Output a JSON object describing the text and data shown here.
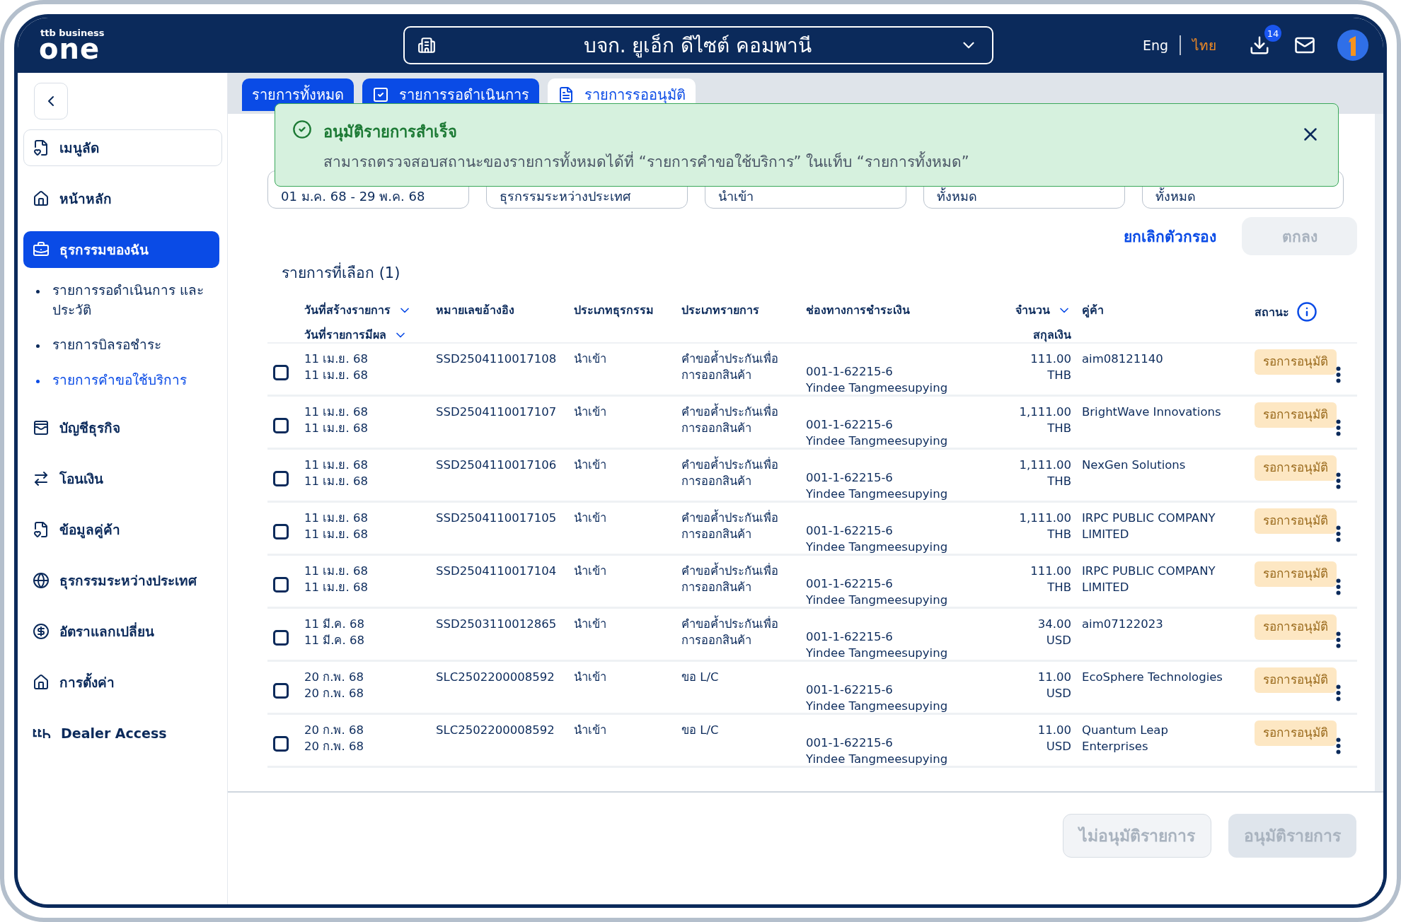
{
  "header": {
    "logo": {
      "tagline": "ttb business",
      "brand": "one"
    },
    "company": "บจก. ยูเอ็ก ดีไซต์ คอมพานี",
    "languages": [
      {
        "label": "Eng",
        "selected": false
      },
      {
        "label": "ไทย",
        "selected": true
      }
    ],
    "download_badge": "14"
  },
  "sidebar": {
    "items": [
      {
        "kind": "shortcut",
        "label": "เมนูลัด",
        "selected": false
      },
      {
        "kind": "nav",
        "label": "หน้าหลัก",
        "selected": false
      },
      {
        "kind": "nav",
        "label": "ธุรกรรมของฉัน",
        "selected": true,
        "children": [
          {
            "label": "รายการรอดำเนินการ และประวัติ",
            "selected": false
          },
          {
            "label": "รายการบิลรอชำระ",
            "selected": false
          },
          {
            "label": "รายการคำขอใช้บริการ",
            "selected": true
          }
        ]
      },
      {
        "kind": "nav",
        "label": "บัญชีธุรกิจ",
        "selected": false
      },
      {
        "kind": "nav",
        "label": "โอนเงิน",
        "selected": false
      },
      {
        "kind": "nav",
        "label": "ข้อมูลคู่ค้า",
        "selected": false
      },
      {
        "kind": "nav",
        "label": "ธุรกรรมระหว่างประเทศ",
        "selected": false
      },
      {
        "kind": "nav",
        "label": "อัตราแลกเปลี่ยน",
        "selected": false
      },
      {
        "kind": "nav",
        "label": "การตั้งค่า",
        "selected": false
      },
      {
        "kind": "nav",
        "label": "Dealer Access",
        "selected": false
      }
    ]
  },
  "tabs": [
    {
      "label": "รายการทั้งหมด",
      "selected": false
    },
    {
      "label": "รายการรอดำเนินการ",
      "selected": false
    },
    {
      "label": "รายการรออนุมัติ",
      "selected": true
    }
  ],
  "toast": {
    "title": "อนุมัติรายการสำเร็จ",
    "message": "สามารถตรวจสอบสถานะของรายการทั้งหมดได้ที่ “รายการคำขอใช้บริการ” ในแท็บ “รายการทั้งหมด”"
  },
  "filters": [
    "01 ม.ค. 68 - 29 พ.ค. 68",
    "ธุรกรรมระหว่างประเทศ",
    "นำเข้า",
    "ทั้งหมด",
    "ทั้งหมด"
  ],
  "filter_actions": {
    "clear": "ยกเลิกตัวกรอง",
    "apply": {
      "label": "ตกลง",
      "disabled": true
    }
  },
  "selected_count": "รายการที่เลือก (1)",
  "table": {
    "columns": [
      {
        "lines": [
          {
            "label": "วันที่สร้างรายการ",
            "sortable": true
          },
          {
            "label": "วันที่รายการมีผล",
            "sortable": true
          }
        ]
      },
      {
        "lines": [
          {
            "label": "หมายเลขอ้างอิง"
          }
        ]
      },
      {
        "lines": [
          {
            "label": "ประเภทธุรกรรม"
          }
        ]
      },
      {
        "lines": [
          {
            "label": "ประเภทรายการ"
          }
        ]
      },
      {
        "lines": [
          {
            "label": "ช่องทางการชำระเงิน"
          }
        ]
      },
      {
        "lines": [
          {
            "label": "จำนวน",
            "sortable": true
          },
          {
            "label": "สกุลเงิน"
          }
        ]
      },
      {
        "lines": [
          {
            "label": "คู่ค้า"
          }
        ]
      },
      {
        "lines": [
          {
            "label": "สถานะ"
          }
        ]
      }
    ],
    "rows": [
      {
        "checked": false,
        "created": "11 เม.ย. 68",
        "effective": "11 เม.ย. 68",
        "reference": "SSD2504110017108",
        "transaction_type": "นำเข้า",
        "item_type": "คำขอค้ำประกันเพื่อการออกสินค้า",
        "account": "001-1-62215-6",
        "account_name": "Yindee Tangmeesupying",
        "amount": "111.00",
        "currency": "THB",
        "partner": "aim08121140",
        "status": "รอการอนุมัติ"
      },
      {
        "checked": false,
        "created": "11 เม.ย. 68",
        "effective": "11 เม.ย. 68",
        "reference": "SSD2504110017107",
        "transaction_type": "นำเข้า",
        "item_type": "คำขอค้ำประกันเพื่อการออกสินค้า",
        "account": "001-1-62215-6",
        "account_name": "Yindee Tangmeesupying",
        "amount": "1,111.00",
        "currency": "THB",
        "partner": "BrightWave Innovations",
        "status": "รอการอนุมัติ"
      },
      {
        "checked": false,
        "created": "11 เม.ย. 68",
        "effective": "11 เม.ย. 68",
        "reference": "SSD2504110017106",
        "transaction_type": "นำเข้า",
        "item_type": "คำขอค้ำประกันเพื่อการออกสินค้า",
        "account": "001-1-62215-6",
        "account_name": "Yindee Tangmeesupying",
        "amount": "1,111.00",
        "currency": "THB",
        "partner": "NexGen Solutions",
        "status": "รอการอนุมัติ"
      },
      {
        "checked": false,
        "created": "11 เม.ย. 68",
        "effective": "11 เม.ย. 68",
        "reference": "SSD2504110017105",
        "transaction_type": "นำเข้า",
        "item_type": "คำขอค้ำประกันเพื่อการออกสินค้า",
        "account": "001-1-62215-6",
        "account_name": "Yindee Tangmeesupying",
        "amount": "1,111.00",
        "currency": "THB",
        "partner": "IRPC PUBLIC COMPANY LIMITED",
        "status": "รอการอนุมัติ"
      },
      {
        "checked": false,
        "created": "11 เม.ย. 68",
        "effective": "11 เม.ย. 68",
        "reference": "SSD2504110017104",
        "transaction_type": "นำเข้า",
        "item_type": "คำขอค้ำประกันเพื่อการออกสินค้า",
        "account": "001-1-62215-6",
        "account_name": "Yindee Tangmeesupying",
        "amount": "111.00",
        "currency": "THB",
        "partner": "IRPC PUBLIC COMPANY LIMITED",
        "status": "รอการอนุมัติ"
      },
      {
        "checked": false,
        "created": "11 มี.ค. 68",
        "effective": "11 มี.ค. 68",
        "reference": "SSD2503110012865",
        "transaction_type": "นำเข้า",
        "item_type": "คำขอค้ำประกันเพื่อการออกสินค้า",
        "account": "001-1-62215-6",
        "account_name": "Yindee Tangmeesupying",
        "amount": "34.00",
        "currency": "USD",
        "partner": "aim07122023",
        "status": "รอการอนุมัติ"
      },
      {
        "checked": false,
        "created": "20 ก.พ. 68",
        "effective": "20 ก.พ. 68",
        "reference": "SLC2502200008592",
        "transaction_type": "นำเข้า",
        "item_type": "ขอ L/C",
        "account": "001-1-62215-6",
        "account_name": "Yindee Tangmeesupying",
        "amount": "11.00",
        "currency": "USD",
        "partner": "EcoSphere Technologies",
        "status": "รอการอนุมัติ"
      },
      {
        "checked": false,
        "created": "20 ก.พ. 68",
        "effective": "20 ก.พ. 68",
        "reference": "SLC2502200008592",
        "transaction_type": "นำเข้า",
        "item_type": "ขอ L/C",
        "account": "001-1-62215-6",
        "account_name": "Yindee Tangmeesupying",
        "amount": "11.00",
        "currency": "USD",
        "partner": "Quantum Leap Enterprises",
        "status": "รอการอนุมัติ"
      }
    ]
  },
  "footer_buttons": [
    {
      "label": "ไม่อนุมัติรายการ",
      "kind": "secondary",
      "disabled": true
    },
    {
      "label": "อนุมัติรายการ",
      "kind": "primary",
      "disabled": true
    }
  ]
}
